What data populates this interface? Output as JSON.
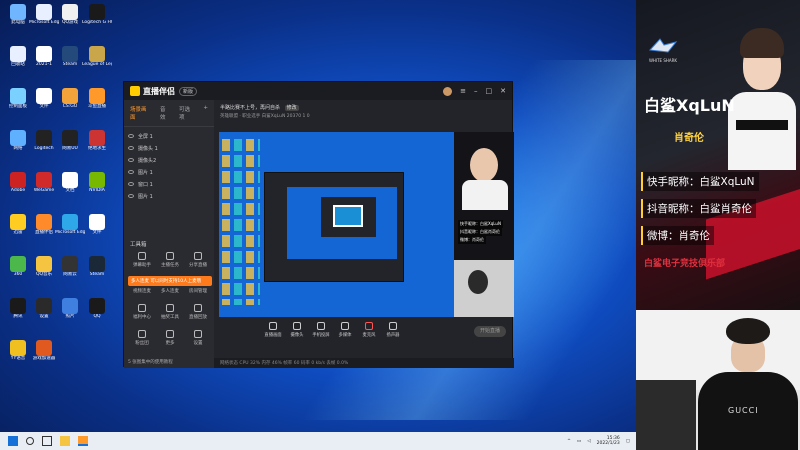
{
  "desktop": {
    "icons": [
      {
        "label": "此电脑",
        "color": "#6fb6ff"
      },
      {
        "label": "Microsoft Edge",
        "color": "#e8f0ff"
      },
      {
        "label": "QQ游戏",
        "color": "#f0f0f0"
      },
      {
        "label": "Logitech G HUB",
        "color": "#1a1a1a"
      },
      {
        "label": "回收站",
        "color": "#e8f0ff"
      },
      {
        "label": "2021-1",
        "color": "#ffffff"
      },
      {
        "label": "Steam",
        "color": "#234a7a"
      },
      {
        "label": "League of Legends",
        "color": "#c9a64a"
      },
      {
        "label": "控制面板",
        "color": "#7ad0ff"
      },
      {
        "label": "文件",
        "color": "#ffffff"
      },
      {
        "label": "CS:GO",
        "color": "#f2a33a"
      },
      {
        "label": "斗鱼直播",
        "color": "#ff9a2a"
      },
      {
        "label": "网络",
        "color": "#5fb0ff"
      },
      {
        "label": "Logitech",
        "color": "#222"
      },
      {
        "label": "网易UU",
        "color": "#222"
      },
      {
        "label": "绝地求生",
        "color": "#cc3333"
      },
      {
        "label": "Adobe",
        "color": "#cc2222"
      },
      {
        "label": "WeGame",
        "color": "#d12a2a"
      },
      {
        "label": "文档",
        "color": "#ffffff"
      },
      {
        "label": "NVIDIA",
        "color": "#76b900"
      },
      {
        "label": "迅雷",
        "color": "#ffcc22"
      },
      {
        "label": "直播伴侣",
        "color": "#ff8a2a"
      },
      {
        "label": "Microsoft Edge",
        "color": "#2ea8e8"
      },
      {
        "label": "文件",
        "color": "#ffffff"
      },
      {
        "label": "360",
        "color": "#4cb84c"
      },
      {
        "label": "QQ音乐",
        "color": "#f5c542"
      },
      {
        "label": "网易云",
        "color": "#333"
      },
      {
        "label": "Steam",
        "color": "#1b2838"
      },
      {
        "label": "腾讯",
        "color": "#1a1a1a"
      },
      {
        "label": "设置",
        "color": "#2a2a2a"
      },
      {
        "label": "照片",
        "color": "#3f7fdf"
      },
      {
        "label": "QQ",
        "color": "#1a1a1a"
      },
      {
        "label": "YY语音",
        "color": "#f0c020"
      },
      {
        "label": "游戏加速器",
        "color": "#e05a20"
      }
    ]
  },
  "app": {
    "title": "直播伴侣",
    "version": "新版",
    "window_controls": [
      "≡",
      "–",
      "□",
      "✕"
    ],
    "left_tabs": [
      "场景画面",
      "音效",
      "可选项",
      "+"
    ],
    "scenes": [
      "全屏 1",
      "摄像头 1",
      "摄像头2",
      "图片 1",
      "窗口 1",
      "图片 1"
    ],
    "tools_title": "工具箱",
    "tools": [
      {
        "label": "弹幕助手"
      },
      {
        "label": "主播任务"
      },
      {
        "label": "分享直播"
      },
      {
        "label": "视频连麦"
      },
      {
        "label": "多人连麦"
      },
      {
        "label": "房间管理"
      },
      {
        "label": "福利中心"
      },
      {
        "label": "抽奖工具"
      },
      {
        "label": "直播回放"
      },
      {
        "label": "粉丝团"
      },
      {
        "label": "更多"
      },
      {
        "label": "设置"
      }
    ],
    "orange_tip": "多人连麦 可以同时支持10人上麦哦",
    "left_footer": "5 张图集中的使用教程",
    "stream_title": "半路比赛不上号，再问自杀",
    "stream_tag": "修改",
    "stream_meta": "英雄联盟 · 职业选手   白鲨XqLuN   20370   1   0",
    "controls": [
      {
        "label": "直播画面"
      },
      {
        "label": "摄像头"
      },
      {
        "label": "手机投屏"
      },
      {
        "label": "多媒体"
      },
      {
        "label": "麦克风",
        "red": true
      },
      {
        "label": "扬声器"
      }
    ],
    "start_button": "开始直播",
    "status_bar": "网络状态  CPU 32%  内存 46%  帧率 60   码率 0 kb/s   丢帧 0.0%"
  },
  "taskbar": {
    "time": "15:36",
    "date": "2022/1/23"
  },
  "right_panel": {
    "team_logo_text": "WHITE SHARK",
    "player_id": "白鲨XqLuN",
    "player_real_name": "肖奇伦",
    "info_lines": [
      "快手昵称：白鲨XqLuN",
      "抖音昵称：白鲨肖奇伦",
      "微博：肖奇伦"
    ],
    "club": "白鲨电子竞技俱乐部",
    "webcam_shirt_text": "GUCCI"
  }
}
